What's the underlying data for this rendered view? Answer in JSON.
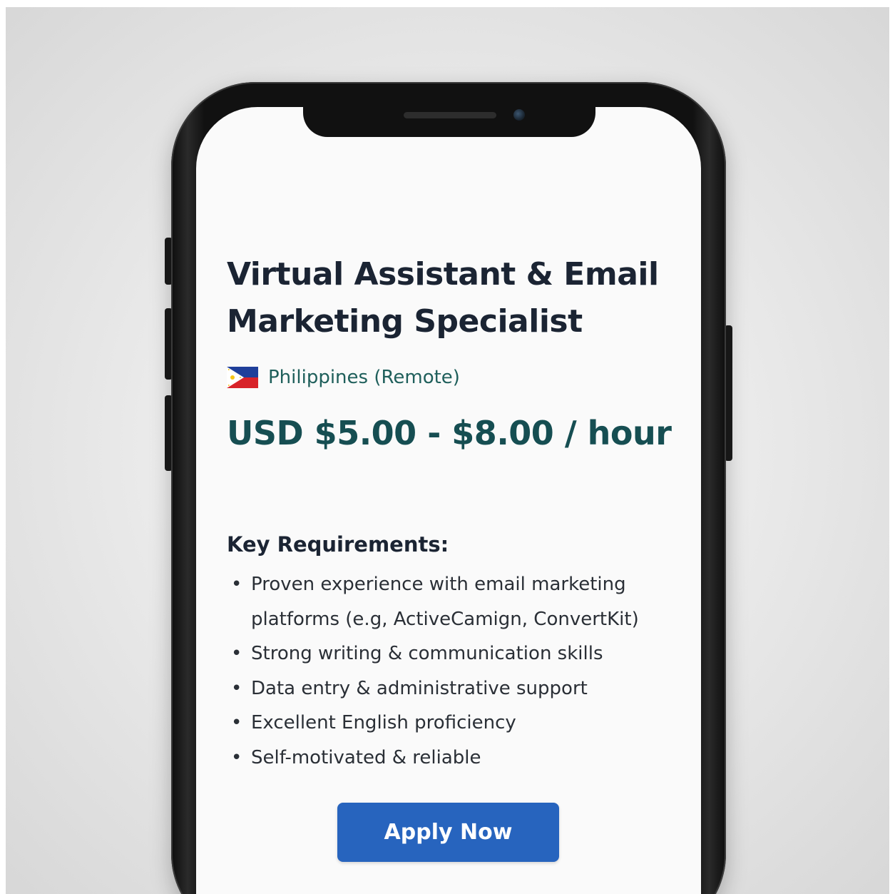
{
  "job": {
    "title": "Virtual Assistant & Email Marketing Specialist",
    "location": "Philippines (Remote)",
    "location_flag_icon": "philippines-flag-icon",
    "salary": "USD $5.00 - $8.00 / hour"
  },
  "requirements": {
    "heading": "Key Requirements:",
    "items": [
      "Proven experience with email marketing platforms (e.g, ActiveCamign, ConvertKit)",
      "Strong writing & communication skills",
      "Data entry & administrative support",
      "Excellent English proficiency",
      "Self-motivated & reliable"
    ]
  },
  "actions": {
    "apply_label": "Apply Now"
  },
  "colors": {
    "title": "#1b2433",
    "accent_teal": "#164e52",
    "button": "#2764be",
    "phone_body": "#111111"
  }
}
